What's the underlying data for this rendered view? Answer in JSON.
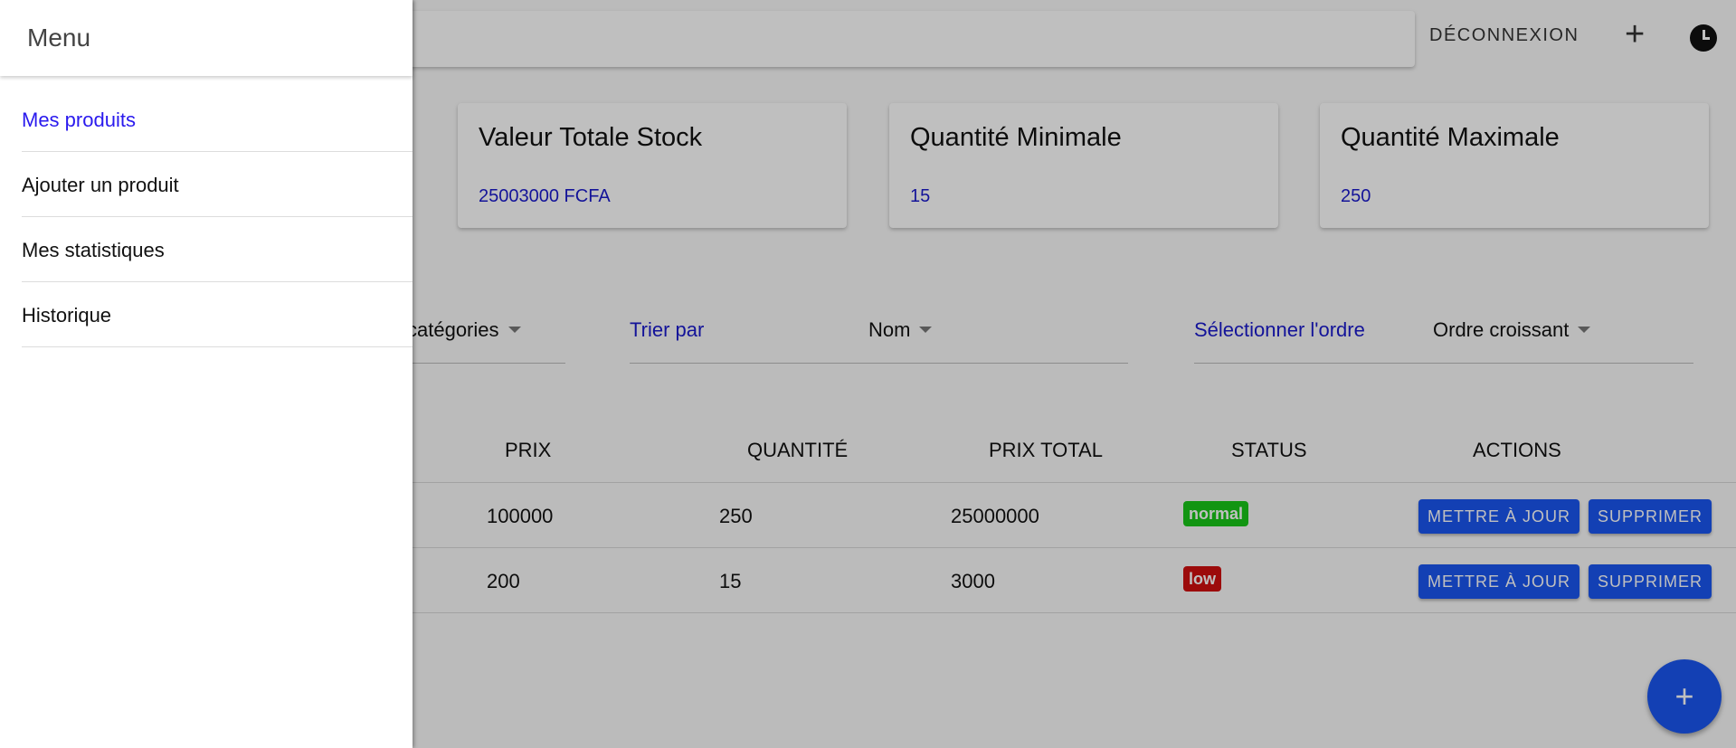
{
  "topbar": {
    "logout_label": "DÉCONNEXION",
    "add_icon": "plus-icon",
    "history_icon": "clock-icon"
  },
  "stats": [
    {
      "title": "Valeur Totale Stock",
      "value": "25003000 FCFA"
    },
    {
      "title": "Quantité Minimale",
      "value": "15"
    },
    {
      "title": "Quantité Maximale",
      "value": "250"
    }
  ],
  "filters": {
    "category_value": "catégories",
    "sort_label": "Trier par",
    "sort_value": "Nom",
    "order_label": "Sélectionner l'ordre",
    "order_value": "Ordre croissant"
  },
  "table": {
    "headers": [
      "PRIX",
      "QUANTITÉ",
      "PRIX TOTAL",
      "STATUS",
      "ACTIONS"
    ],
    "rows": [
      {
        "prix": "100000",
        "quantite": "250",
        "prix_total": "25000000",
        "status": "normal"
      },
      {
        "prix": "200",
        "quantite": "15",
        "prix_total": "3000",
        "status": "low"
      }
    ],
    "update_label": "METTRE À JOUR",
    "delete_label": "SUPPRIMER"
  },
  "fab": {
    "label": "+"
  },
  "drawer": {
    "title": "Menu",
    "items": [
      "Mes produits",
      "Ajouter un produit",
      "Mes statistiques",
      "Historique"
    ]
  },
  "colors": {
    "link": "#1a1acc",
    "primary": "#1a56f0",
    "status_normal": "#18c718",
    "status_low": "#d10f0f",
    "drawer_active": "#2a1aee"
  }
}
